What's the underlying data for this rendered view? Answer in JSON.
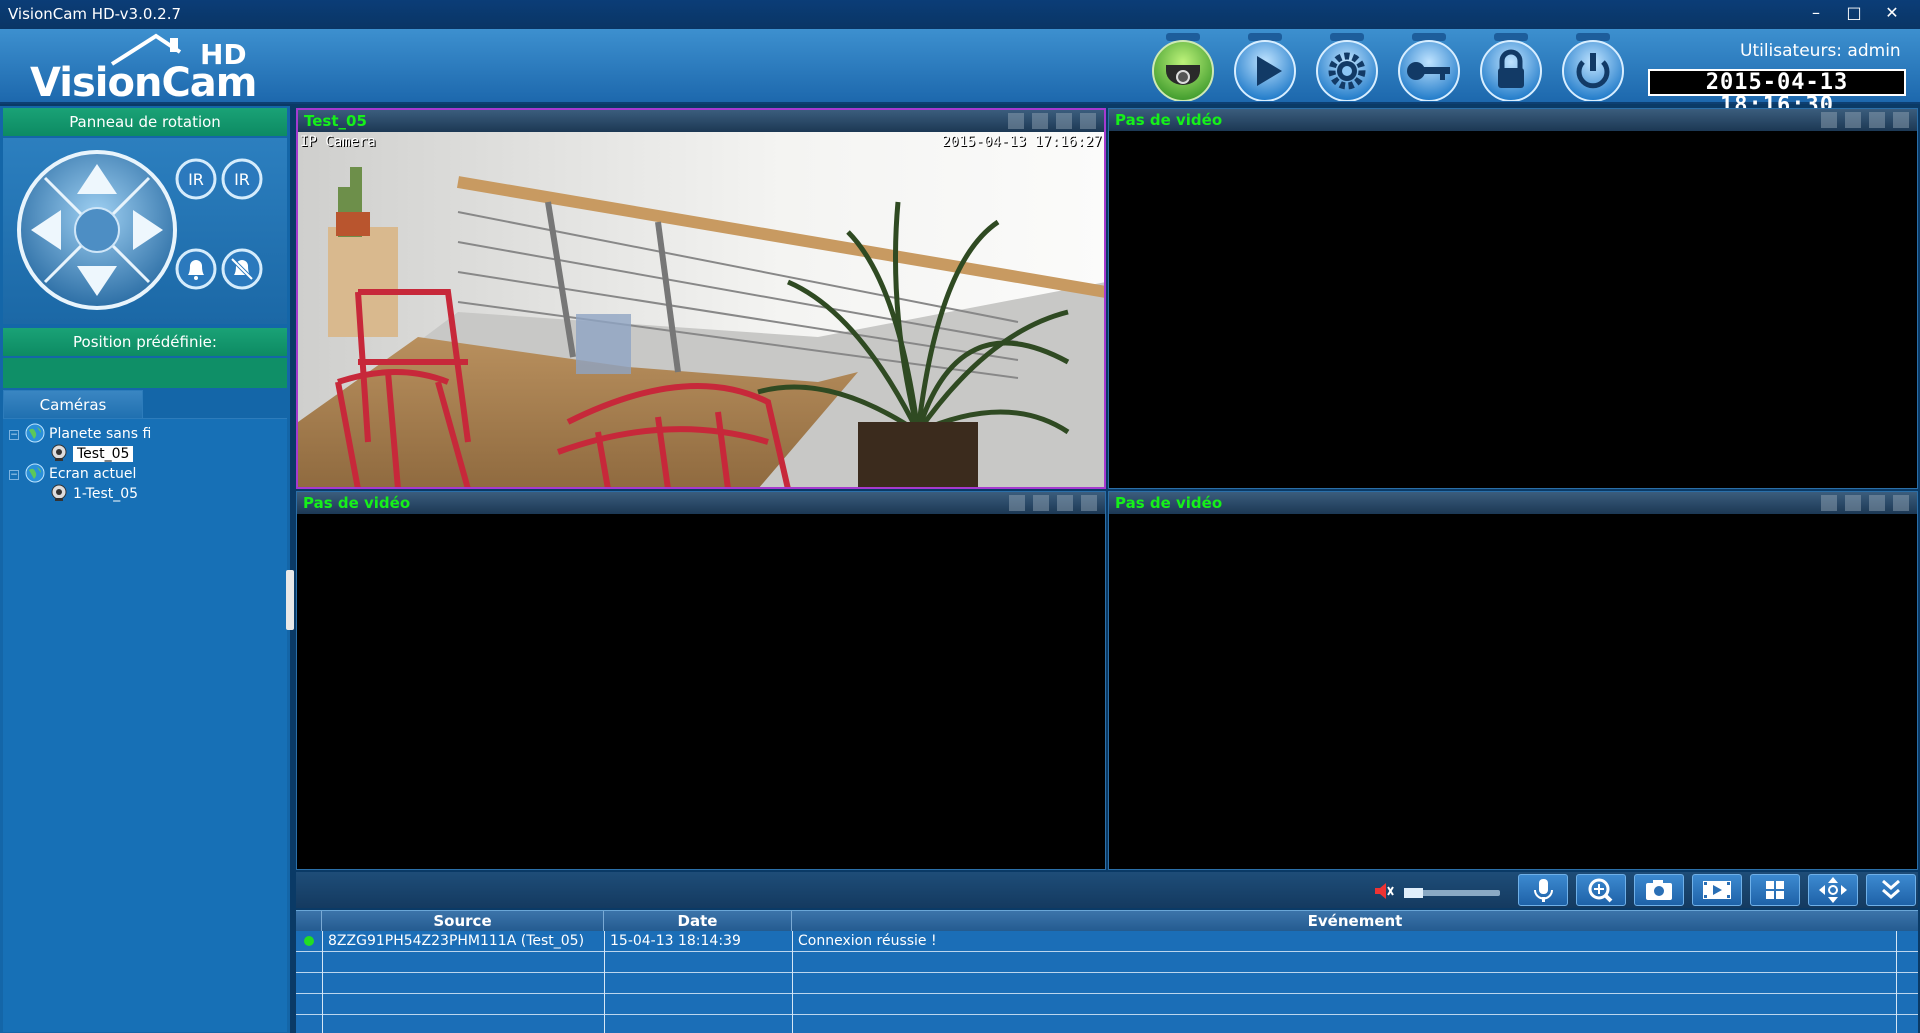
{
  "window": {
    "title": "VisionCam HD-v3.0.2.7",
    "controls": [
      "–",
      "□",
      "✕"
    ]
  },
  "logo": {
    "name": "VisionCam",
    "suffix": "HD"
  },
  "toolbar": {
    "buttons": [
      {
        "name": "camera-icon",
        "accent": "#3f9b2c"
      },
      {
        "name": "play-icon",
        "accent": "#1e79c8"
      },
      {
        "name": "settings-gear-icon",
        "accent": "#1e79c8"
      },
      {
        "name": "key-icon",
        "accent": "#1e79c8"
      },
      {
        "name": "lock-icon",
        "accent": "#1e79c8"
      },
      {
        "name": "power-icon",
        "accent": "#1e79c8"
      }
    ],
    "user_label": "Utilisateurs: admin",
    "clock": "2015-04-13 18:16:30"
  },
  "left_panel": {
    "rotation_title": "Panneau de rotation",
    "ptz_buttons": [
      "IR",
      "IR"
    ],
    "preset_title": "Position prédéfinie:",
    "cameras_tab": "Caméras",
    "tree": [
      {
        "label": "Planete sans fi",
        "expander": "−",
        "children": [
          "Test_05"
        ]
      },
      {
        "label": "Ecran actuel",
        "expander": "−",
        "children": [
          "1-Test_05"
        ]
      }
    ]
  },
  "video_cells": [
    {
      "title": "Test_05",
      "osd_left": "IP Camera",
      "osd_right": "2015-04-13 17:16:27",
      "active": true
    },
    {
      "title": "Pas de vidéo",
      "active": false
    },
    {
      "title": "Pas de vidéo",
      "active": false
    },
    {
      "title": "Pas de vidéo",
      "active": false
    }
  ],
  "bottom_toolbar": {
    "volume_level": 0.2,
    "buttons": [
      "microphone-icon",
      "zoom-in-icon",
      "snapshot-camera-icon",
      "record-film-icon",
      "grid-layout-icon",
      "fullscreen-arrows-icon",
      "chevron-down-double-icon"
    ]
  },
  "event_log": {
    "columns": [
      "Source",
      "Date",
      "Evénement"
    ],
    "rows": [
      {
        "status_color": "#22dd22",
        "source": "8ZZG91PH54Z23PHM111A (Test_05)",
        "date": "15-04-13 18:14:39",
        "event": "Connexion réussie !"
      }
    ]
  },
  "colors": {
    "accent_green_text": "#16f01a",
    "panel_green": "#0f8f67",
    "panel_blue": "#1466a8",
    "header_blue": "#2f80c4",
    "active_border": "#a53ad0"
  }
}
